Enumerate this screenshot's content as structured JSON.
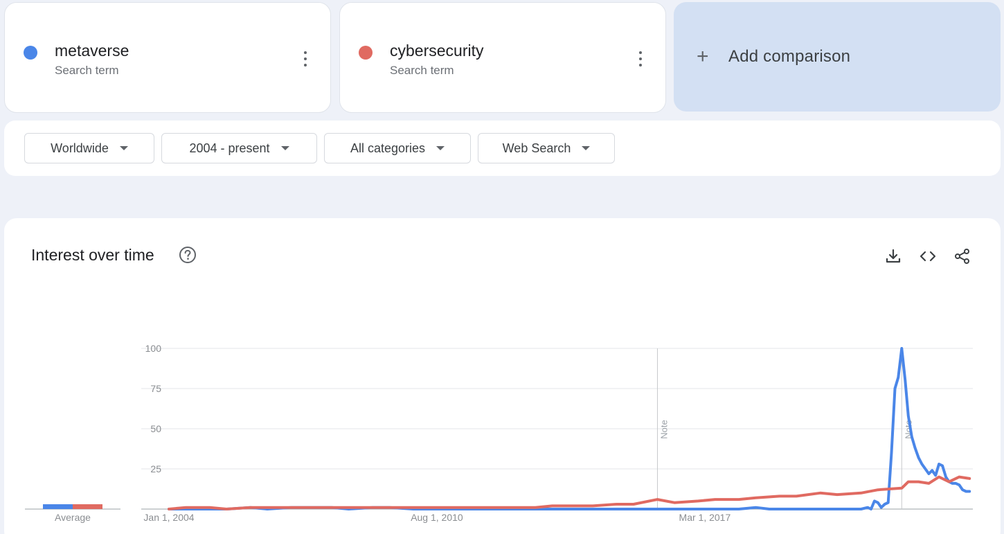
{
  "terms": [
    {
      "name": "metaverse",
      "sub": "Search term",
      "color": "#4a86e8"
    },
    {
      "name": "cybersecurity",
      "sub": "Search term",
      "color": "#e06a61"
    }
  ],
  "add_comparison": {
    "label": "Add comparison",
    "icon": "plus-icon"
  },
  "filters": [
    {
      "label": "Worldwide",
      "icon": "caret-down-icon"
    },
    {
      "label": "2004 - present",
      "icon": "caret-down-icon"
    },
    {
      "label": "All categories",
      "icon": "caret-down-icon"
    },
    {
      "label": "Web Search",
      "icon": "caret-down-icon"
    }
  ],
  "interest": {
    "title": "Interest over time",
    "icons": [
      "help-icon",
      "download-icon",
      "embed-icon",
      "share-icon"
    ]
  },
  "chart_data": {
    "type": "line",
    "x_start": "Jan 1, 2004",
    "x_end": "2024",
    "x_tick_labels": [
      "Jan 1, 2004",
      "Aug 1, 2010",
      "Mar 1, 2017"
    ],
    "x_tick_dates": [
      "2004-01-01",
      "2010-08-01",
      "2017-03-01"
    ],
    "y_ticks": [
      25,
      50,
      75,
      100
    ],
    "ylim": [
      0,
      100
    ],
    "grid": true,
    "average_label": "Average",
    "averages": [
      3,
      3
    ],
    "notes": [
      {
        "label": "Note",
        "date": "2016-01-01"
      },
      {
        "label": "Note",
        "date": "2022-01-01"
      }
    ],
    "series": [
      {
        "name": "metaverse",
        "color": "#4a86e8",
        "points": [
          [
            "2004-01-01",
            0
          ],
          [
            "2005-06-01",
            0
          ],
          [
            "2006-01-01",
            1
          ],
          [
            "2006-06-01",
            0
          ],
          [
            "2007-01-01",
            1
          ],
          [
            "2008-01-01",
            1
          ],
          [
            "2008-06-01",
            0
          ],
          [
            "2009-01-01",
            1
          ],
          [
            "2009-06-01",
            1
          ],
          [
            "2010-01-01",
            0
          ],
          [
            "2012-01-01",
            0
          ],
          [
            "2014-01-01",
            0
          ],
          [
            "2016-01-01",
            0
          ],
          [
            "2018-01-01",
            0
          ],
          [
            "2018-06-01",
            1
          ],
          [
            "2018-10-01",
            0
          ],
          [
            "2020-01-01",
            0
          ],
          [
            "2021-01-01",
            0
          ],
          [
            "2021-03-01",
            1
          ],
          [
            "2021-04-01",
            0
          ],
          [
            "2021-05-01",
            5
          ],
          [
            "2021-06-01",
            4
          ],
          [
            "2021-07-01",
            1
          ],
          [
            "2021-08-01",
            3
          ],
          [
            "2021-09-01",
            4
          ],
          [
            "2021-10-01",
            35
          ],
          [
            "2021-11-01",
            75
          ],
          [
            "2021-12-01",
            82
          ],
          [
            "2022-01-01",
            100
          ],
          [
            "2022-02-01",
            80
          ],
          [
            "2022-03-01",
            58
          ],
          [
            "2022-04-01",
            45
          ],
          [
            "2022-05-01",
            38
          ],
          [
            "2022-06-01",
            32
          ],
          [
            "2022-07-01",
            28
          ],
          [
            "2022-08-01",
            25
          ],
          [
            "2022-09-01",
            22
          ],
          [
            "2022-10-01",
            24
          ],
          [
            "2022-11-01",
            21
          ],
          [
            "2022-12-01",
            28
          ],
          [
            "2023-01-01",
            27
          ],
          [
            "2023-02-01",
            20
          ],
          [
            "2023-03-01",
            17
          ],
          [
            "2023-04-01",
            16
          ],
          [
            "2023-05-01",
            16
          ],
          [
            "2023-06-01",
            15
          ],
          [
            "2023-07-01",
            12
          ],
          [
            "2023-08-01",
            11
          ],
          [
            "2023-09-01",
            11
          ]
        ]
      },
      {
        "name": "cybersecurity",
        "color": "#e06a61",
        "points": [
          [
            "2004-01-01",
            0
          ],
          [
            "2004-06-01",
            1
          ],
          [
            "2005-01-01",
            1
          ],
          [
            "2005-06-01",
            0
          ],
          [
            "2006-01-01",
            1
          ],
          [
            "2007-01-01",
            1
          ],
          [
            "2008-01-01",
            1
          ],
          [
            "2009-01-01",
            1
          ],
          [
            "2010-01-01",
            1
          ],
          [
            "2011-01-01",
            1
          ],
          [
            "2012-01-01",
            1
          ],
          [
            "2013-01-01",
            1
          ],
          [
            "2013-06-01",
            2
          ],
          [
            "2014-01-01",
            2
          ],
          [
            "2014-06-01",
            2
          ],
          [
            "2015-01-01",
            3
          ],
          [
            "2015-06-01",
            3
          ],
          [
            "2016-01-01",
            6
          ],
          [
            "2016-06-01",
            4
          ],
          [
            "2017-01-01",
            5
          ],
          [
            "2017-06-01",
            6
          ],
          [
            "2018-01-01",
            6
          ],
          [
            "2018-06-01",
            7
          ],
          [
            "2019-01-01",
            8
          ],
          [
            "2019-06-01",
            8
          ],
          [
            "2020-01-01",
            10
          ],
          [
            "2020-06-01",
            9
          ],
          [
            "2021-01-01",
            10
          ],
          [
            "2021-06-01",
            12
          ],
          [
            "2022-01-01",
            13
          ],
          [
            "2022-03-01",
            17
          ],
          [
            "2022-06-01",
            17
          ],
          [
            "2022-09-01",
            16
          ],
          [
            "2022-12-01",
            20
          ],
          [
            "2023-03-01",
            17
          ],
          [
            "2023-06-01",
            20
          ],
          [
            "2023-09-01",
            19
          ]
        ]
      }
    ]
  }
}
